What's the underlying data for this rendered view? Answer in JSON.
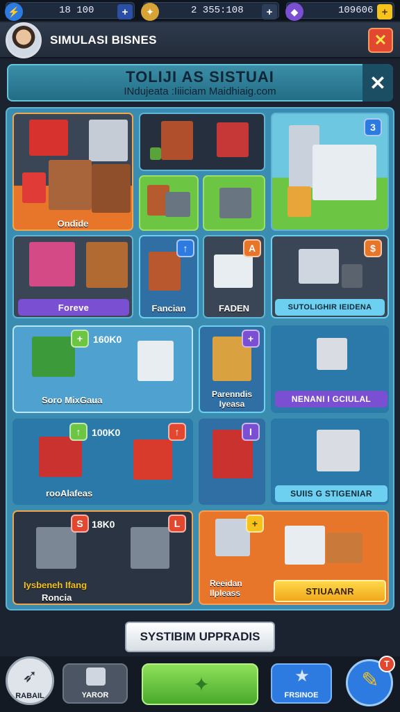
{
  "topbar": {
    "energy": "18 100",
    "coins": "2 355:108",
    "gems": "109606",
    "plus": "+"
  },
  "header": {
    "title": "SIMULASI BISNES",
    "close": "✕"
  },
  "banner": {
    "title": "TOLIJI AS SISTUAI",
    "subtitle": "INdujeata :Iiiiciam Maidhiaig.com",
    "close": "✕"
  },
  "tiles": {
    "shop_large_label": "Ondide",
    "tower_badge": "3",
    "shelf_bar": "Foreve",
    "facade_badge": "↑",
    "facade_label": "Fancian",
    "store_badge": "A",
    "store_label": "FADEN",
    "stall_badge": "$",
    "stall_bar": "SUTOLIGHIR IEIDENA",
    "green_market_badge": "+",
    "green_market_num": "160K0",
    "green_market_label": "Soro MixGaua",
    "booth_badge": "+",
    "booth_label": "Parenndis Iyeasa",
    "cart_bar": "NENANI I GCIULAL",
    "basket_badge": "↑",
    "basket_num": "100K0",
    "basket_badge2": "↑",
    "basket_label": "rooAlafeas",
    "booth2_badge": "I",
    "trolley_bar": "SUIIS G STIGENIAR",
    "dark_badge": "S",
    "dark_num": "18K0",
    "dark_badge2": "L",
    "dark_label1": "Iysbeneh Ifang",
    "dark_label2": "Roncia",
    "orange_badge": "+",
    "orange_label": "Reeidan Ilpleass",
    "orange_button": "STIUAANR"
  },
  "upgrade_button": "SYSTIBIM UPPRADIS",
  "bottom_nav": {
    "nav1": "RABAIL",
    "nav2": "YAROR",
    "nav4": "FRSINOE",
    "notif": "T"
  },
  "colors": {
    "panel": "#3a8db0",
    "orange": "#e7762a",
    "green": "#6cc644",
    "purple": "#7a4fd1",
    "gold": "#f6c21c"
  }
}
